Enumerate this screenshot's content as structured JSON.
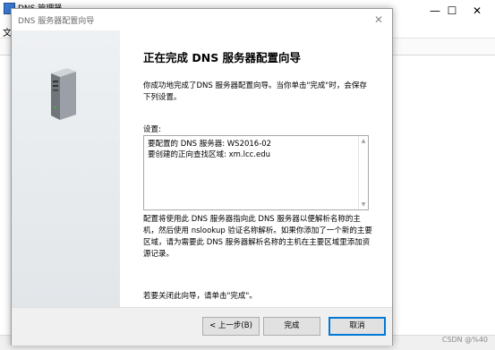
{
  "background_window": {
    "title": "DNS 管理器",
    "menu_letter": "文",
    "minimize": "—",
    "maximize": "☐",
    "close": "✕"
  },
  "dialog": {
    "title": "DNS 服务器配置向导",
    "close": "✕",
    "heading": "正在完成 DNS 服务器配置向导",
    "intro": "你成功地完成了DNS 服务器配置向导。当你单击\"完成\"时，会保存下列设置。",
    "settings_label": "设置:",
    "settings_text": "要配置的 DNS 服务器: WS2016-02\n要创建的正向查找区域: xm.lcc.edu",
    "description": "配置将使用此 DNS 服务器指向此 DNS 服务器以便解析名称的主机，然后使用 nslookup 验证名称解析。如果你添加了一个新的主要区域，请为需要此 DNS 服务器解析名称的主机在主要区域里添加资源记录。",
    "close_note": "若要关闭此向导，请单击\"完成\"。",
    "buttons": {
      "back": "< 上一步(B)",
      "finish": "完成",
      "cancel": "取消"
    }
  },
  "watermark": "CSDN @%40",
  "colors": {
    "accent": "#0078d7",
    "side_panel": "#e6e9ec",
    "button_face": "#e1e1e1"
  }
}
